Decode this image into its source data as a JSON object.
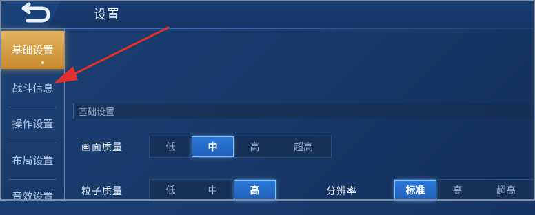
{
  "header": {
    "title": "设置"
  },
  "sidebar": {
    "items": [
      {
        "label": "基础设置"
      },
      {
        "label": "战斗信息"
      },
      {
        "label": "操作设置"
      },
      {
        "label": "布局设置"
      },
      {
        "label": "音效设置"
      }
    ],
    "active_index": 0
  },
  "section": {
    "title": "基础设置"
  },
  "settings": {
    "graphics_quality": {
      "label": "画面质量",
      "options": [
        "低",
        "中",
        "高",
        "超高"
      ],
      "selected": "中"
    },
    "particle_quality": {
      "label": "粒子质量",
      "options": [
        "低",
        "中",
        "高"
      ],
      "selected": "高"
    },
    "resolution": {
      "label": "分辨率",
      "options": [
        "标准",
        "高",
        "超高"
      ],
      "selected": "标准"
    }
  },
  "colors": {
    "accent": "#2b78d8",
    "active_tab": "#d9a24a",
    "annotation_arrow": "#e2312b"
  },
  "icons": {
    "back": "back-arrow-icon"
  }
}
